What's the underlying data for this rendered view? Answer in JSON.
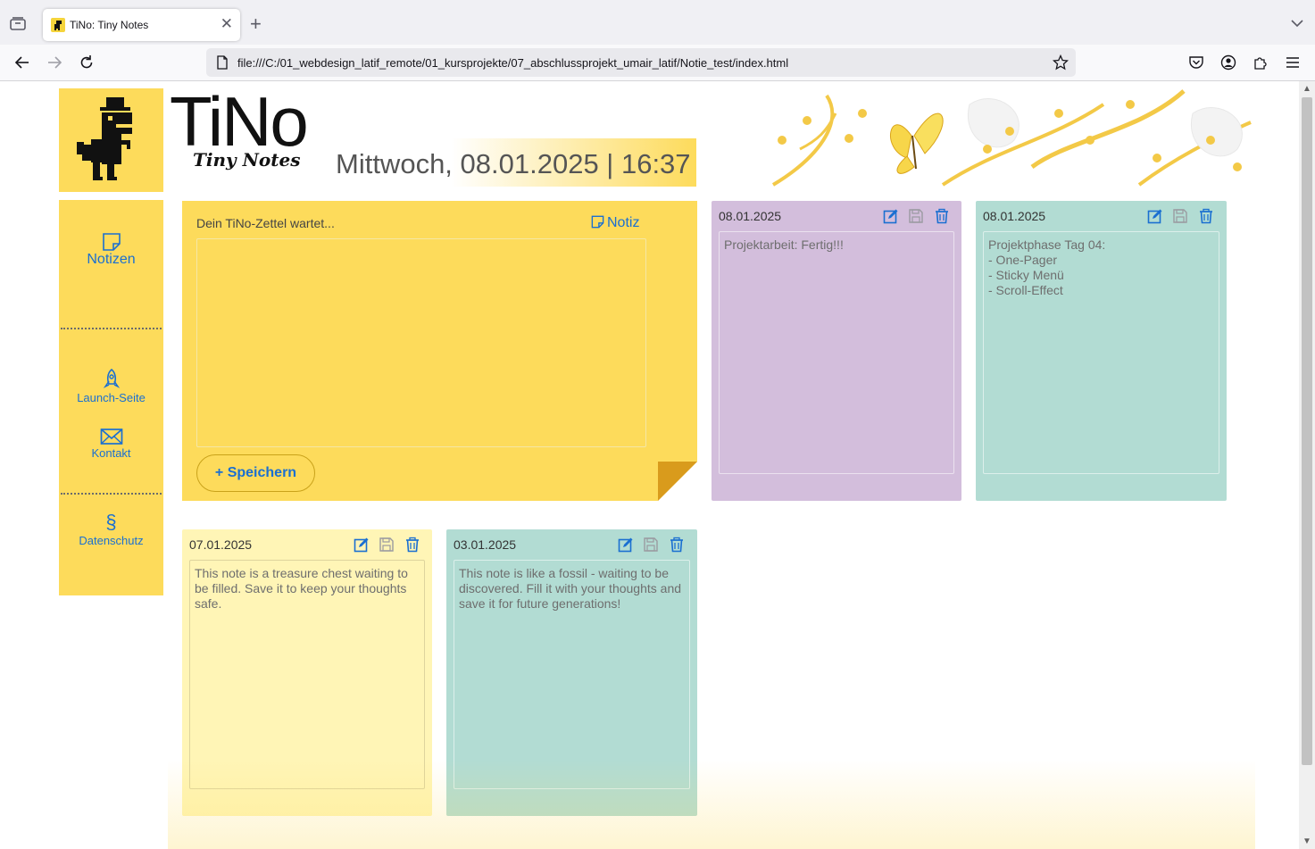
{
  "browser": {
    "tab_title": "TiNo: Tiny Notes",
    "tab_close": "✕",
    "new_tab": "+",
    "url": "file:///C:/01_webdesign_latif_remote/01_kursprojekte/07_abschlussprojekt_umair_latif/Notie_test/index.html"
  },
  "header": {
    "brand_title": "TiNo",
    "brand_subtitle": "Tiny Notes",
    "datetime": "Mittwoch, 08.01.2025 | 16:37"
  },
  "sidebar": {
    "items": [
      {
        "label": "Notizen",
        "icon": "note-icon"
      },
      {
        "label": "Launch-Seite",
        "icon": "rocket-icon"
      },
      {
        "label": "Kontakt",
        "icon": "envelope-icon"
      },
      {
        "label": "Datenschutz",
        "icon": "section-sign-icon",
        "glyph": "§"
      }
    ]
  },
  "compose": {
    "placeholder": "Dein TiNo-Zettel wartet...",
    "notiz_label": "Notiz",
    "save_label": "+ Speichern"
  },
  "notes": [
    {
      "date": "08.01.2025",
      "text": "Projektarbeit: Fertig!!!",
      "color": "#d3bedc"
    },
    {
      "date": "08.01.2025",
      "text": "Projektphase Tag 04:\n- One-Pager\n- Sticky Menü\n- Scroll-Effect",
      "color": "#b2dcd3"
    },
    {
      "date": "07.01.2025",
      "text": "This note is a treasure chest waiting to be filled. Save it to keep your thoughts safe.",
      "color": "#fff5b6"
    },
    {
      "date": "03.01.2025",
      "text": "This note is like a fossil - waiting to be discovered. Fill it with your thoughts and save it for future generations!",
      "color": "#b2dcd3"
    }
  ],
  "colors": {
    "accent_yellow": "#fddb5b",
    "link_blue": "#1a6fd1",
    "fold_orange": "#d99b1c"
  }
}
